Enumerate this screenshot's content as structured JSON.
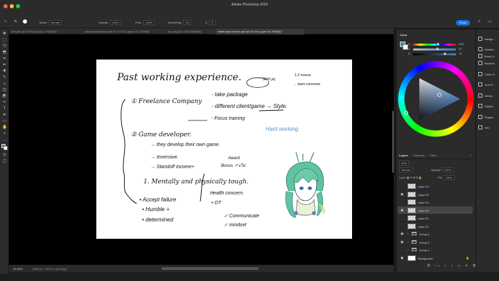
{
  "app": {
    "title": "Adobe Photoshop 2024",
    "share_label": "Share"
  },
  "options_bar": {
    "mode_label": "Mode:",
    "mode_value": "Normal",
    "opacity_label": "Opacity:",
    "opacity_value": "100%",
    "flow_label": "Flow:",
    "flow_value": "100%",
    "smoothing_label": "Smoothing:",
    "smoothing_value": "0%",
    "angle_value": "0°"
  },
  "tabs": [
    {
      "label": "ture.psd @ 9.42% (Group 2, RGB/8) *"
    },
    {
      "label": "vobnna-flowmerial.psd @ 17.1% (Layer 144, RGB/8)"
    },
    {
      "label": "mp.png @ 8.33% (RGB/8#)"
    },
    {
      "label": "whiteboard screen.psd @ 33.3% (Layer 26, RGB/8) *"
    }
  ],
  "status": {
    "zoom": "33.33%",
    "info": "3860 px x 2578 px (300 ppi)"
  },
  "color_panel": {
    "title": "Color",
    "sliders": [
      {
        "label": "H",
        "value": "208",
        "position": 0.58
      },
      {
        "label": "S",
        "value": "57",
        "position": 0.57
      },
      {
        "label": "B",
        "value": "74",
        "position": 0.74
      }
    ],
    "foreground": "#4f7fb0",
    "background": "#ffffff"
  },
  "layers_panel": {
    "tabs": [
      "Layers",
      "Channels",
      "Paths"
    ],
    "kind_label": "Kind",
    "blend_mode": "Normal",
    "opacity_label": "Opacity:",
    "opacity_value": "100%",
    "lock_label": "Lock:",
    "fill_label": "Fill:",
    "fill_value": "100%",
    "layers": [
      {
        "name": "Layer 23",
        "visible": false,
        "type": "layer",
        "selected": false
      },
      {
        "name": "Layer 25",
        "visible": true,
        "type": "layer",
        "selected": false
      },
      {
        "name": "Layer 24",
        "visible": false,
        "type": "layer",
        "selected": false
      },
      {
        "name": "Layer 26",
        "visible": true,
        "type": "layer",
        "selected": true
      },
      {
        "name": "Layer 22",
        "visible": false,
        "type": "layer",
        "selected": false
      },
      {
        "name": "Layer 21",
        "visible": false,
        "type": "layer",
        "selected": false
      },
      {
        "name": "Group 4",
        "visible": true,
        "type": "group",
        "selected": false
      },
      {
        "name": "Group 3",
        "visible": true,
        "type": "group",
        "selected": false
      },
      {
        "name": "Group 1",
        "visible": false,
        "type": "group",
        "selected": false
      },
      {
        "name": "Background",
        "visible": true,
        "type": "background",
        "selected": false
      }
    ]
  },
  "right_panels": [
    {
      "label": "Navige..."
    },
    {
      "label": "Swatch..."
    },
    {
      "label": "Brush S..."
    },
    {
      "label": "Brushes"
    },
    {
      "label": "Clone S..."
    },
    {
      "label": "Tool Pr..."
    },
    {
      "label": "Librari..."
    },
    {
      "label": "Glyphs"
    },
    {
      "label": "Plugins"
    },
    {
      "label": "Info"
    }
  ],
  "document": {
    "heading": "Past working experience.",
    "note_circled": "3000 pq",
    "note_side_1": "1-2 mouse",
    "note_side_2": "→ team consume",
    "item1": "① Freelance Company",
    "item1_points": [
      "- take package",
      "- different client/game → Style.",
      "- Focus training"
    ],
    "hard_working": "Hard working.",
    "item2": "② Game developer.",
    "item2_points": [
      "→ they develop their own game.",
      "→ Invensive.",
      "→ Standoff income+"
    ],
    "award": "Award",
    "bonus": "Bonus ↗ vTa'.",
    "item3": "1. Mentally and physically tough.",
    "list_left": [
      "• Accept failure",
      "• Humble +",
      "• determined"
    ],
    "list_mid": [
      "Health concern.",
      "• OT"
    ],
    "list_right": [
      "✓ Communicate",
      "✓ mindset"
    ]
  }
}
